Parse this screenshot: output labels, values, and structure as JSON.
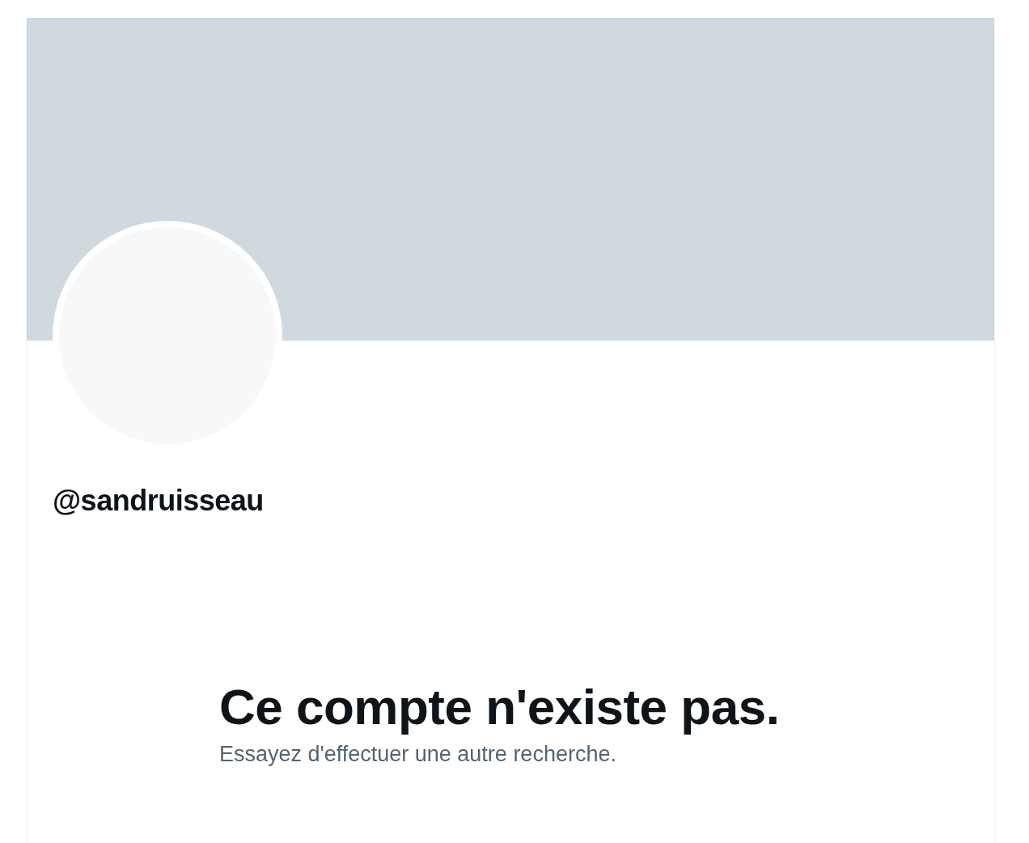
{
  "profile": {
    "handle": "@sandruisseau"
  },
  "message": {
    "title": "Ce compte n'existe pas.",
    "subtitle": "Essayez d'effectuer une autre recherche."
  }
}
